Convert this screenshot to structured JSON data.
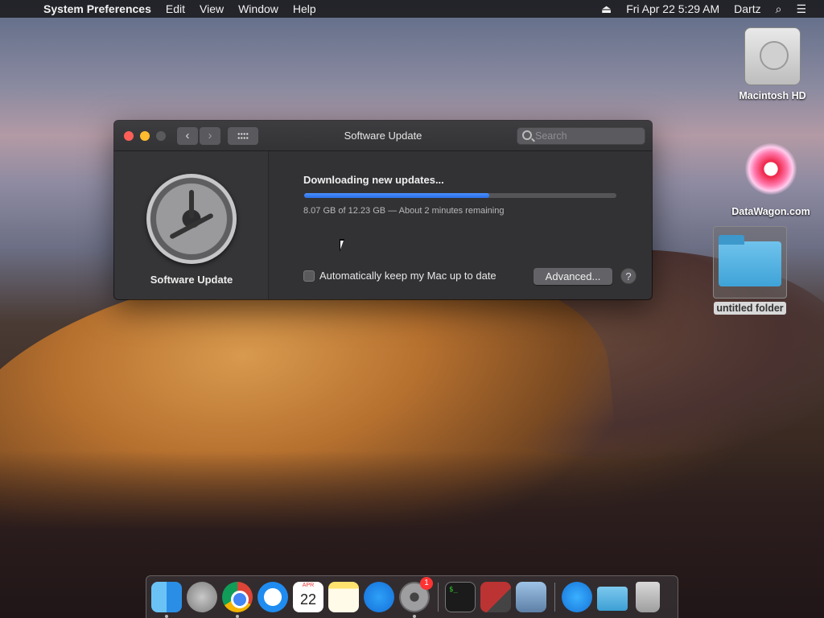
{
  "menubar": {
    "app_name": "System Preferences",
    "items": [
      "Edit",
      "View",
      "Window",
      "Help"
    ],
    "datetime": "Fri Apr 22  5:29 AM",
    "user": "Dartz"
  },
  "desktop": {
    "icons": [
      {
        "label": "Macintosh HD"
      },
      {
        "label": "DataWagon.com"
      },
      {
        "label": "untitled folder"
      }
    ]
  },
  "window": {
    "title": "Software Update",
    "search_placeholder": "Search",
    "sidebar_label": "Software Update",
    "status": "Downloading new updates...",
    "progress_fraction": 0.593,
    "progress_text": "8.07 GB of 12.23 GB — About 2 minutes remaining",
    "auto_update_label": "Automatically keep my Mac up to date",
    "auto_update_checked": false,
    "advanced_label": "Advanced...",
    "help_label": "?"
  },
  "dock": {
    "calendar_month": "APR",
    "calendar_day": "22",
    "terminal_text": "$_",
    "system_preferences_badge": "1"
  },
  "colors": {
    "close": "#fe5f57",
    "minimize": "#febc2e",
    "progress": "#2a6fe6"
  }
}
